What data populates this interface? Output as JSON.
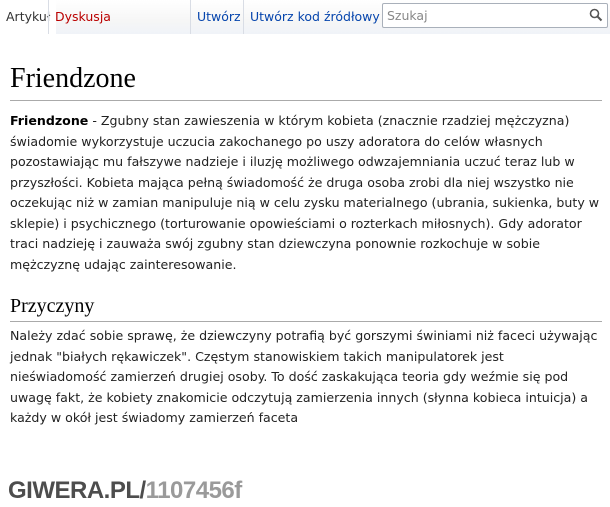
{
  "tabs": {
    "article": "Artykuł",
    "discussion": "Dyskusja",
    "create": "Utwórz",
    "create_source": "Utwórz kod źródłowy"
  },
  "search": {
    "placeholder": "Szukaj"
  },
  "page": {
    "title": "Friendzone",
    "intro_term": "Friendzone",
    "intro_text": " - Zgubny stan zawieszenia w którym kobieta (znacznie rzadziej mężczyzna) świadomie wykorzystuje uczucia zakochanego po uszy adoratora do celów własnych pozostawiając mu fałszywe nadzieje i iluzję możliwego odwzajemniania uczuć teraz lub w przyszłości. Kobieta mająca pełną świadomość że druga osoba zrobi dla niej wszystko nie oczekując niż w zamian manipuluje nią w celu zysku materialnego (ubrania, sukienka, buty w sklepie) i psychicznego (torturowanie opowieściami o rozterkach miłosnych). Gdy adorator traci nadzieję i zauważa swój zgubny stan dziewczyna ponownie rozkochuje w sobie mężczyznę udając zainteresowanie.",
    "section_title": "Przyczyny",
    "section_text": "Należy zdać sobie sprawę, że dziewczyny potrafią być gorszymi świniami niż faceci używając jednak \"białych rękawiczek\". Częstym stanowiskiem takich manipulatorek jest nieświadomość zamierzeń drugiej osoby. To dość zaskakująca teoria gdy weźmie się pod uwagę fakt, że kobiety znakomicie odczytują zamierzenia innych (słynna kobieca intuicja) a każdy w okół jest świadomy zamierzeń faceta"
  },
  "watermark": {
    "site": "GIWERA.PL/",
    "id": "1107456f"
  }
}
